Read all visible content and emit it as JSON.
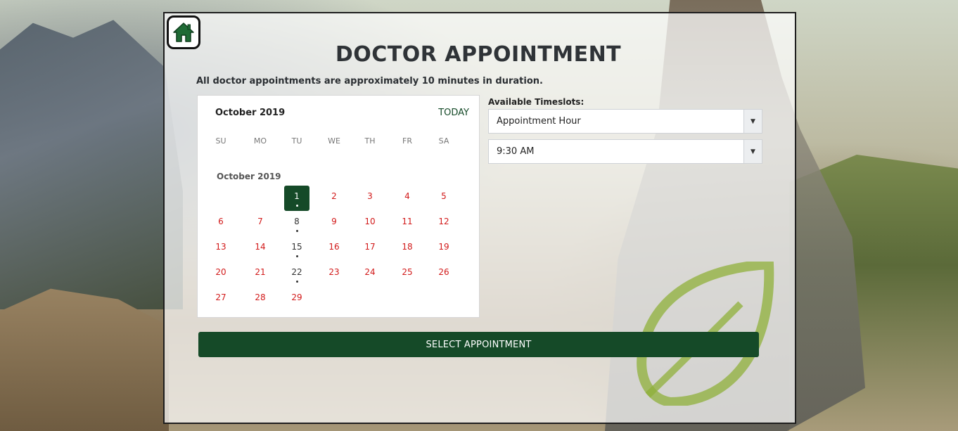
{
  "header": {
    "title": "DOCTOR APPOINTMENT",
    "subtitle": "All doctor appointments are approximately 10 minutes in duration."
  },
  "calendar": {
    "month_label": "October 2019",
    "today_label": "TODAY",
    "weekdays": [
      "SU",
      "MO",
      "TU",
      "WE",
      "TH",
      "FR",
      "SA"
    ],
    "section_month_label": "October 2019",
    "selected_day": 1,
    "available_days": [
      1,
      8,
      15,
      22
    ],
    "weeks": [
      [
        null,
        null,
        1,
        2,
        3,
        4,
        5
      ],
      [
        6,
        7,
        8,
        9,
        10,
        11,
        12
      ],
      [
        13,
        14,
        15,
        16,
        17,
        18,
        19
      ],
      [
        20,
        21,
        22,
        23,
        24,
        25,
        26
      ],
      [
        27,
        28,
        29,
        null,
        null,
        null,
        null
      ]
    ]
  },
  "timeslots": {
    "label": "Available Timeslots:",
    "hour_select": {
      "value": "Appointment Hour",
      "arrow": "▼"
    },
    "time_select": {
      "value": "9:30 AM",
      "arrow": "▼"
    }
  },
  "actions": {
    "submit_label": "SELECT APPOINTMENT"
  },
  "colors": {
    "accent": "#154a28",
    "unavailable_day": "#d21a1a",
    "leaf": "#8fb03a"
  },
  "icons": {
    "home": "home-icon",
    "dropdown": "chevron-down-icon",
    "logo": "leaf-logo"
  }
}
